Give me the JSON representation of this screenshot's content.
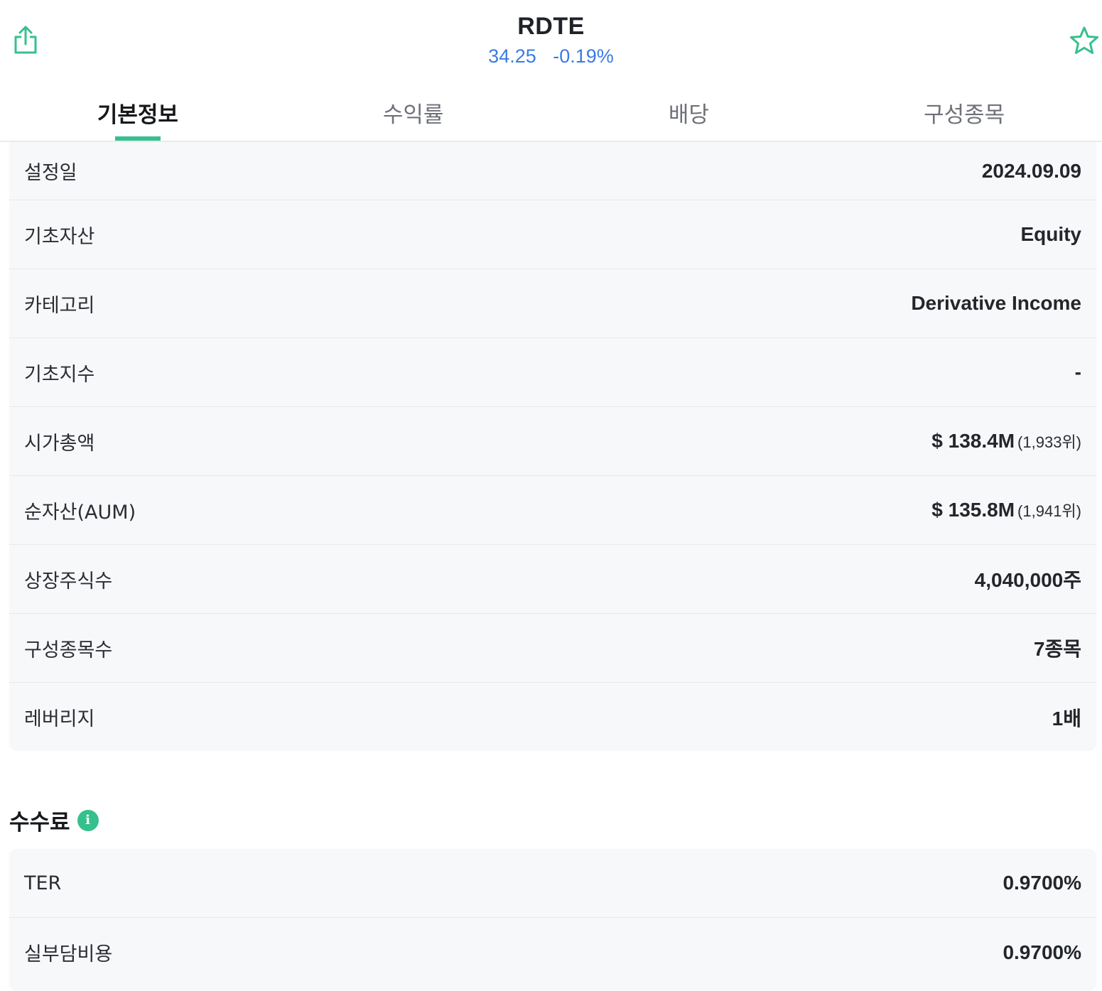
{
  "header": {
    "ticker": "RDTE",
    "price": "34.25",
    "change": "-0.19%",
    "share_icon": "share-icon",
    "favorite_icon": "star-icon"
  },
  "colors": {
    "accent": "#36c08e",
    "price": "#3a7be2"
  },
  "tabs": [
    {
      "label": "기본정보",
      "active": true
    },
    {
      "label": "수익률",
      "active": false
    },
    {
      "label": "배당",
      "active": false
    },
    {
      "label": "구성종목",
      "active": false
    }
  ],
  "basic_info": [
    {
      "label": "설정일",
      "value": "2024.09.09",
      "rank": ""
    },
    {
      "label": "기초자산",
      "value": "Equity",
      "rank": ""
    },
    {
      "label": "카테고리",
      "value": "Derivative Income",
      "rank": ""
    },
    {
      "label": "기초지수",
      "value": "-",
      "rank": ""
    },
    {
      "label": "시가총액",
      "value": "$ 138.4M",
      "rank": "(1,933위)"
    },
    {
      "label": "순자산(AUM)",
      "value": "$ 135.8M",
      "rank": "(1,941위)"
    },
    {
      "label": "상장주식수",
      "value": "4,040,000주",
      "rank": ""
    },
    {
      "label": "구성종목수",
      "value": "7종목",
      "rank": ""
    },
    {
      "label": "레버리지",
      "value": "1배",
      "rank": ""
    }
  ],
  "fees": {
    "title": "수수료",
    "info_icon": "i",
    "rows": [
      {
        "label": "TER",
        "value": "0.9700%"
      },
      {
        "label": "실부담비용",
        "value": "0.9700%"
      }
    ]
  }
}
